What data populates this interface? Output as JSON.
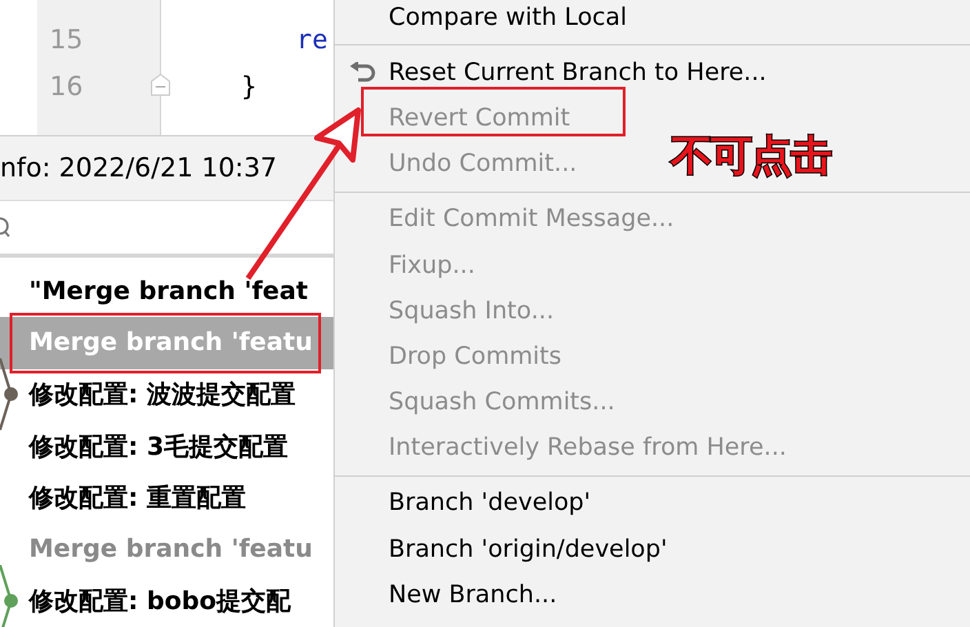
{
  "editor": {
    "lines": [
      {
        "number": "15",
        "code": "re"
      },
      {
        "number": "16",
        "code": "}"
      }
    ]
  },
  "info_bar": {
    "text": "nfo: 2022/6/21 10:37"
  },
  "commits": [
    {
      "message": "\"Merge branch 'feat",
      "selected": false,
      "muted": false
    },
    {
      "message": "Merge branch 'featu",
      "selected": true,
      "muted": false
    },
    {
      "message": "修改配置: 波波提交配置",
      "selected": false,
      "muted": false,
      "color": "#6b625a"
    },
    {
      "message": "修改配置: 3毛提交配置",
      "selected": false,
      "muted": false
    },
    {
      "message": "修改配置: 重置配置",
      "selected": false,
      "muted": false
    },
    {
      "message": "Merge branch 'featu",
      "selected": false,
      "muted": true
    },
    {
      "message": "修改配置: bobo提交配",
      "selected": false,
      "muted": false,
      "color": "#5fa05a"
    }
  ],
  "context_menu": [
    {
      "kind": "item",
      "label": "Compare with Local",
      "disabled": false
    },
    {
      "kind": "separator"
    },
    {
      "kind": "icon_item",
      "label": "Reset Current Branch to Here...",
      "disabled": false
    },
    {
      "kind": "item",
      "label": "Revert Commit",
      "disabled": true
    },
    {
      "kind": "item",
      "label": "Undo Commit...",
      "disabled": true
    },
    {
      "kind": "separator"
    },
    {
      "kind": "item",
      "label": "Edit Commit Message...",
      "disabled": true
    },
    {
      "kind": "item",
      "label": "Fixup...",
      "disabled": true
    },
    {
      "kind": "item",
      "label": "Squash Into...",
      "disabled": true
    },
    {
      "kind": "item",
      "label": "Drop Commits",
      "disabled": true
    },
    {
      "kind": "item",
      "label": "Squash Commits...",
      "disabled": true
    },
    {
      "kind": "item",
      "label": "Interactively Rebase from Here...",
      "disabled": true
    },
    {
      "kind": "separator"
    },
    {
      "kind": "item",
      "label": "Branch 'develop'",
      "disabled": false
    },
    {
      "kind": "item",
      "label": "Branch 'origin/develop'",
      "disabled": false
    },
    {
      "kind": "item",
      "label": "New Branch...",
      "disabled": false
    }
  ],
  "annotation": {
    "label": "不可点击"
  }
}
